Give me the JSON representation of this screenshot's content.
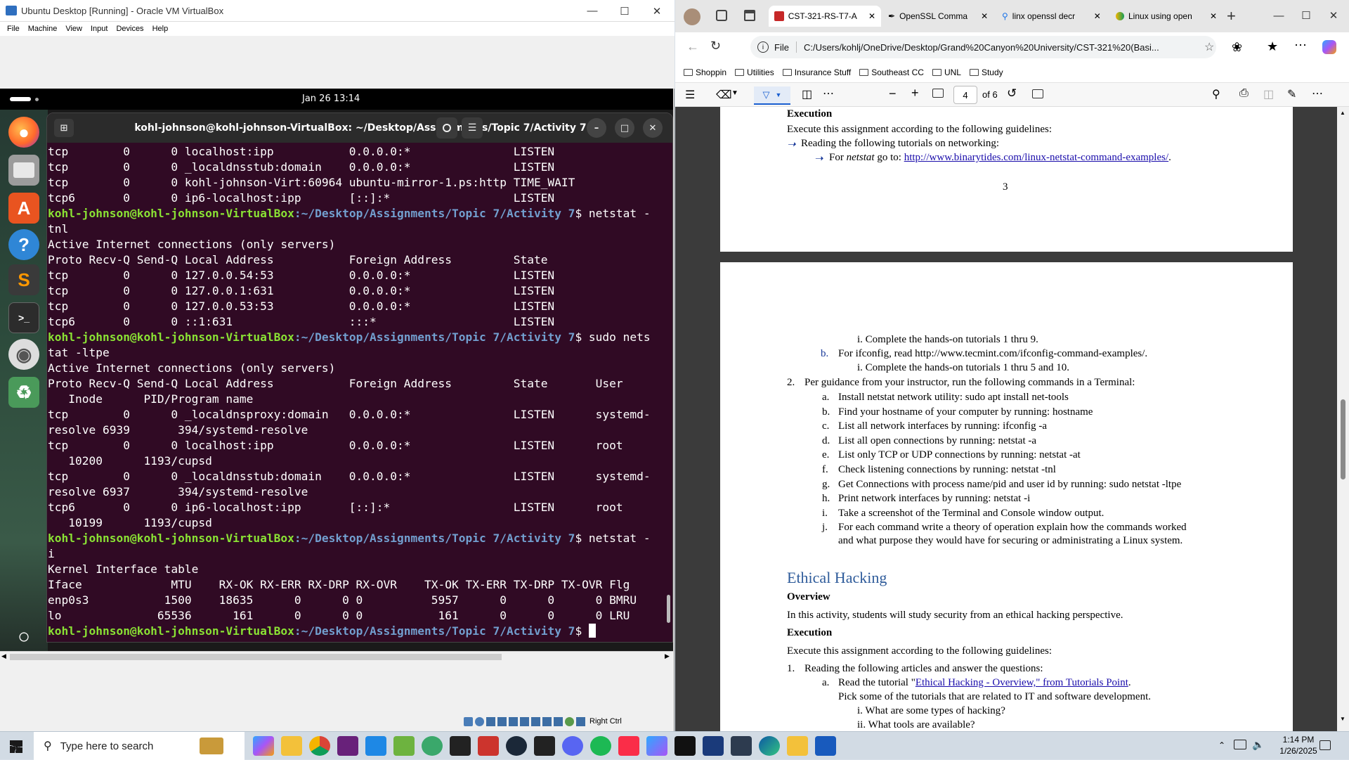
{
  "vbox": {
    "title": "Ubuntu Desktop [Running] - Oracle VM VirtualBox",
    "menu": [
      "File",
      "Machine",
      "View",
      "Input",
      "Devices",
      "Help"
    ],
    "status_right_ctrl": "Right Ctrl"
  },
  "ubuntu": {
    "clock": "Jan 26  13:14",
    "terminal_title": "kohl-johnson@kohl-johnson-VirtualBox: ~/Desktop/Assignments/Topic 7/Activity 7",
    "prompt_user": "kohl-johnson@kohl-johnson-VirtualBox",
    "prompt_path": ":~/Desktop/Assignments/Topic 7/Activity 7",
    "lines": [
      {
        "t": "tcp        0      0 localhost:ipp           0.0.0.0:*               LISTEN"
      },
      {
        "t": "tcp        0      0 _localdnsstub:domain    0.0.0.0:*               LISTEN"
      },
      {
        "t": "tcp        0      0 kohl-johnson-Virt:60964 ubuntu-mirror-1.ps:http TIME_WAIT"
      },
      {
        "t": "tcp6       0      0 ip6-localhost:ipp       [::]:*                  LISTEN"
      },
      {
        "prompt": true,
        "cmd": "$ netstat -"
      },
      {
        "t": "tnl"
      },
      {
        "t": "Active Internet connections (only servers)"
      },
      {
        "t": "Proto Recv-Q Send-Q Local Address           Foreign Address         State"
      },
      {
        "t": "tcp        0      0 127.0.0.54:53           0.0.0.0:*               LISTEN"
      },
      {
        "t": "tcp        0      0 127.0.0.1:631           0.0.0.0:*               LISTEN"
      },
      {
        "t": "tcp        0      0 127.0.0.53:53           0.0.0.0:*               LISTEN"
      },
      {
        "t": "tcp6       0      0 ::1:631                 :::*                    LISTEN"
      },
      {
        "prompt": true,
        "cmd": "$ sudo nets"
      },
      {
        "t": "tat -ltpe"
      },
      {
        "t": "Active Internet connections (only servers)"
      },
      {
        "t": "Proto Recv-Q Send-Q Local Address           Foreign Address         State       User"
      },
      {
        "t": "   Inode      PID/Program name"
      },
      {
        "t": "tcp        0      0 _localdnsproxy:domain   0.0.0.0:*               LISTEN      systemd-"
      },
      {
        "t": "resolve 6939       394/systemd-resolve"
      },
      {
        "t": "tcp        0      0 localhost:ipp           0.0.0.0:*               LISTEN      root"
      },
      {
        "t": "   10200      1193/cupsd"
      },
      {
        "t": "tcp        0      0 _localdnsstub:domain    0.0.0.0:*               LISTEN      systemd-"
      },
      {
        "t": "resolve 6937       394/systemd-resolve"
      },
      {
        "t": "tcp6       0      0 ip6-localhost:ipp       [::]:*                  LISTEN      root"
      },
      {
        "t": "   10199      1193/cupsd"
      },
      {
        "prompt": true,
        "cmd": "$ netstat -"
      },
      {
        "t": "i"
      },
      {
        "t": "Kernel Interface table"
      },
      {
        "t": "Iface             MTU    RX-OK RX-ERR RX-DRP RX-OVR    TX-OK TX-ERR TX-DRP TX-OVR Flg"
      },
      {
        "t": "enp0s3           1500    18635      0      0 0          5957      0      0      0 BMRU"
      },
      {
        "t": "lo              65536      161      0      0 0           161      0      0      0 LRU"
      },
      {
        "prompt": true,
        "cmd": "$ ",
        "cursor": true
      }
    ]
  },
  "edge": {
    "tabs": [
      {
        "label": "CST-321-RS-T7-A"
      },
      {
        "label": "OpenSSL Comma"
      },
      {
        "label": "linx openssl decr"
      },
      {
        "label": "Linux using open"
      }
    ],
    "file_label": "File",
    "url": "C:/Users/kohlj/OneDrive/Desktop/Grand%20Canyon%20University/CST-321%20(Basi...",
    "bookmarks": [
      "Shoppin",
      "Utilities",
      "Insurance Stuff",
      "Southeast CC",
      "UNL",
      "Study"
    ],
    "page_num": "4",
    "page_total": "of 6"
  },
  "pdf": {
    "page1": {
      "execution": "Execution",
      "exec_intro": "Execute this assignment according to the following guidelines:",
      "item1": "Reading the following tutorials on networking:",
      "item1a_pre": "For ",
      "item1a_em": "netstat",
      "item1a_mid": " go to: ",
      "item1a_link": "http://www.binarytides.com/linux-netstat-command-examples/",
      "item1a_end": ".",
      "page_number": "3"
    },
    "page2": {
      "i1": "i.   Complete the hands-on tutorials 1 thru 9.",
      "b": "b.",
      "b_text": "For ifconfig, read http://www.tecmint.com/ifconfig-command-examples/.",
      "i2": "i.   Complete the hands-on tutorials 1 thru 5 and 10.",
      "n2": "2.",
      "n2_text": "Per guidance from your instructor, run the following commands in a Terminal:",
      "list": [
        {
          "m": "a.",
          "t": "Install netstat network utility: sudo apt install net-tools"
        },
        {
          "m": "b.",
          "t": "Find your hostname of your computer by running: hostname"
        },
        {
          "m": "c.",
          "t": "List all network interfaces by running: ifconfig -a"
        },
        {
          "m": "d.",
          "t": "List all open connections by running: netstat -a"
        },
        {
          "m": "e.",
          "t": "List only TCP or UDP connections by running: netstat -at"
        },
        {
          "m": "f.",
          "t": "Check listening connections by running: netstat -tnl"
        },
        {
          "m": "g.",
          "t": "Get Connections with process name/pid and user id by running: sudo netstat -ltpe"
        },
        {
          "m": "h.",
          "t": "Print network interfaces by running: netstat -i"
        },
        {
          "m": "i.",
          "t": "Take a screenshot of the Terminal and Console window output."
        },
        {
          "m": "j.",
          "t": "For each command write a theory of operation explain how the commands worked"
        }
      ],
      "j_cont": "and what purpose they would have for securing or administrating a Linux system.",
      "heading": "Ethical Hacking",
      "overview": "Overview",
      "overview_text": "In this activity, students will study security from an ethical hacking perspective.",
      "execution": "Execution",
      "exec_intro": "Execute this assignment according to the following guidelines:",
      "n1": "1.",
      "n1_text": "Reading the following articles and answer the questions:",
      "a": "a.",
      "a_pre": "Read the tutorial \"",
      "a_link": "Ethical Hacking - Overview,\" from Tutorials Point",
      "a_end": ".",
      "a_cont": "Pick some of the tutorials that are related to IT and software development.",
      "q1": "i.   What are some types of hacking?",
      "q2": "ii.  What tools are available?"
    }
  },
  "taskbar": {
    "search_placeholder": "Type here to search",
    "time": "1:14 PM",
    "date": "1/26/2025",
    "apps": [
      "copilot",
      "file-explorer",
      "chrome",
      "visual-studio",
      "vscode",
      "spring",
      "browser",
      "unity",
      "ruby",
      "steam",
      "epic-games",
      "discord",
      "spotify",
      "itunes",
      "m365",
      "bar",
      "r",
      "box",
      "edge",
      "file-manager",
      "word"
    ]
  }
}
